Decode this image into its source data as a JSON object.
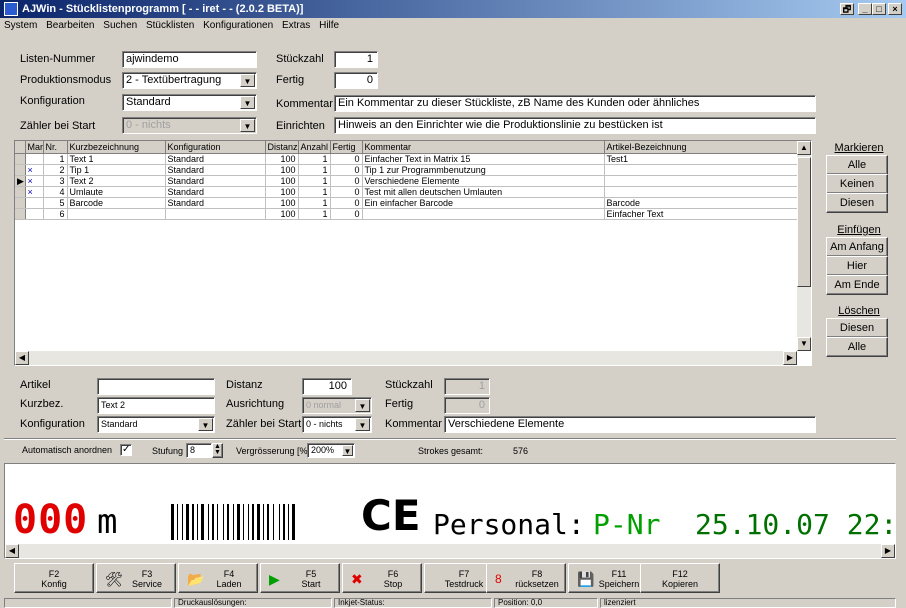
{
  "window": {
    "title": "AJWin - Stücklistenprogramm [ - - iret - - (2.0.2 BETA)]",
    "btn_restore": "▭",
    "btn_min": "_",
    "btn_max": "□",
    "btn_close": "×",
    "btn_extra": "🗗"
  },
  "menu": [
    "System",
    "Bearbeiten",
    "Suchen",
    "Stücklisten",
    "Konfigurationen",
    "Extras",
    "Hilfe"
  ],
  "form": {
    "listen_nummer_label": "Listen-Nummer",
    "listen_nummer": "ajwindemo",
    "produktionsmodus_label": "Produktionsmodus",
    "produktionsmodus": "2 - Textübertragung",
    "konfiguration_label": "Konfiguration",
    "konfiguration": "Standard",
    "zaehler_label": "Zähler bei Start",
    "zaehler": "0 - nichts",
    "stueckzahl_label": "Stückzahl",
    "stueckzahl": "1",
    "fertig_label": "Fertig",
    "fertig": "0",
    "kommentar_label": "Kommentar",
    "kommentar": "Ein Kommentar zu dieser Stückliste, zB Name des Kunden oder ähnliches",
    "einrichten_label": "Einrichten",
    "einrichten": "Hinweis an den Einrichter wie die Produktionslinie zu bestücken ist"
  },
  "table": {
    "headers": [
      "Markiert",
      "Nr.",
      "Kurzbezeichnung",
      "Konfiguration",
      "Distanz",
      "Anzahl",
      "Fertig",
      "Kommentar",
      "Artikel-Bezeichnung"
    ],
    "rows": [
      {
        "ptr": "",
        "mark": "",
        "nr": "1",
        "kurz": "Text 1",
        "konf": "Standard",
        "dist": "100",
        "anz": "1",
        "fertig": "0",
        "komm": "Einfacher Text in Matrix 15",
        "art": "Test1"
      },
      {
        "ptr": "",
        "mark": "×",
        "nr": "2",
        "kurz": "Tip 1",
        "konf": "Standard",
        "dist": "100",
        "anz": "1",
        "fertig": "0",
        "komm": "Tip 1 zur Programmbenutzung",
        "art": ""
      },
      {
        "ptr": "▶",
        "mark": "×",
        "nr": "3",
        "kurz": "Text 2",
        "konf": "Standard",
        "dist": "100",
        "anz": "1",
        "fertig": "0",
        "komm": "Verschiedene Elemente",
        "art": ""
      },
      {
        "ptr": "",
        "mark": "×",
        "nr": "4",
        "kurz": "Umlaute",
        "konf": "Standard",
        "dist": "100",
        "anz": "1",
        "fertig": "0",
        "komm": "Test mit allen deutschen Umlauten",
        "art": ""
      },
      {
        "ptr": "",
        "mark": "",
        "nr": "5",
        "kurz": "Barcode",
        "konf": "Standard",
        "dist": "100",
        "anz": "1",
        "fertig": "0",
        "komm": "Ein einfacher Barcode",
        "art": "Barcode"
      },
      {
        "ptr": "",
        "mark": "",
        "nr": "6",
        "kurz": "",
        "konf": "",
        "dist": "100",
        "anz": "1",
        "fertig": "0",
        "komm": "",
        "art": "Einfacher Text"
      }
    ]
  },
  "side": {
    "markieren": "Markieren",
    "alle": "Alle",
    "keinen": "Keinen",
    "diesen": "Diesen",
    "einfuegen": "Einfügen",
    "am_anfang": "Am Anfang",
    "hier": "Hier",
    "am_ende": "Am Ende",
    "loeschen": "Löschen",
    "l_diesen": "Diesen",
    "l_alle": "Alle"
  },
  "detail": {
    "artikel_label": "Artikel",
    "artikel": "",
    "kurzbez_label": "Kurzbez.",
    "kurzbez": "Text 2",
    "konfiguration_label": "Konfiguration",
    "konfiguration": "Standard",
    "distanz_label": "Distanz",
    "distanz": "100",
    "ausrichtung_label": "Ausrichtung",
    "ausrichtung": "0 normal",
    "zaehler_label": "Zähler bei Start",
    "zaehler": "0 - nichts",
    "stueckzahl_label": "Stückzahl",
    "stueckzahl": "1",
    "fertig_label": "Fertig",
    "fertig": "0",
    "kommentar_label": "Kommentar",
    "kommentar": "Verschiedene Elemente"
  },
  "options": {
    "auto_label": "Automatisch anordnen",
    "auto_check": "✓",
    "stufung_label": "Stufung",
    "stufung": "8",
    "vergr_label": "Vergrösserung [%]",
    "vergr": "200%",
    "strokes_label": "Strokes gesamt:",
    "strokes": "576"
  },
  "preview": {
    "red_text": "000",
    "m_text": "m",
    "ce_text": "CE",
    "personal": "Personal:",
    "pnr": "P-Nr",
    "date": "25.10.07 22:"
  },
  "fkeys": [
    {
      "key": "F2",
      "label": "Konfig",
      "icon": ""
    },
    {
      "key": "F3",
      "label": "Service",
      "icon": "🛠"
    },
    {
      "key": "F4",
      "label": "Laden",
      "icon": "📂"
    },
    {
      "key": "F5",
      "label": "Start",
      "icon": "▶"
    },
    {
      "key": "F6",
      "label": "Stop",
      "icon": "✖"
    },
    {
      "key": "F7",
      "label": "Testdruck",
      "icon": ""
    },
    {
      "key": "F8",
      "label": "rücksetzen",
      "icon": "8"
    },
    {
      "key": "F11",
      "label": "Speichern",
      "icon": "💾"
    },
    {
      "key": "F12",
      "label": "Kopieren",
      "icon": ""
    }
  ],
  "status": {
    "s1": "",
    "s2": "Druckauslösungen:",
    "s3": "Inkjet-Status:",
    "s4": "Position: 0,0",
    "s5": "lizenziert"
  },
  "colors": {
    "red": "#e00000",
    "green": "#00a000",
    "title": "#0a246a"
  }
}
